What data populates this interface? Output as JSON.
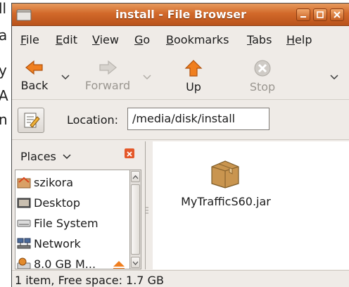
{
  "background_doc": {
    "lines": [
      "ll",
      "a",
      "y",
      "A",
      "n"
    ]
  },
  "window": {
    "title": "install - File Browser",
    "controls": {
      "minimize": "minimize",
      "maximize": "maximize",
      "close": "close"
    }
  },
  "menubar": {
    "items": [
      {
        "label": "File",
        "mnemonic": "F",
        "rest": "ile"
      },
      {
        "label": "Edit",
        "mnemonic": "E",
        "rest": "dit"
      },
      {
        "label": "View",
        "mnemonic": "V",
        "rest": "iew"
      },
      {
        "label": "Go",
        "mnemonic": "G",
        "rest": "o"
      },
      {
        "label": "Bookmarks",
        "mnemonic": "B",
        "rest": "ookmarks"
      },
      {
        "label": "Tabs",
        "mnemonic": "T",
        "rest": "abs"
      },
      {
        "label": "Help",
        "mnemonic": "H",
        "rest": "elp"
      }
    ]
  },
  "toolbar": {
    "back": {
      "label": "Back",
      "enabled": true,
      "icon": "back-arrow-icon"
    },
    "forward": {
      "label": "Forward",
      "enabled": false,
      "icon": "forward-arrow-icon"
    },
    "up": {
      "label": "Up",
      "enabled": true,
      "icon": "up-arrow-icon"
    },
    "stop": {
      "label": "Stop",
      "enabled": false,
      "icon": "stop-icon"
    }
  },
  "location": {
    "label": "Location:",
    "value": "/media/disk/install"
  },
  "sidebar": {
    "header": "Places",
    "items": [
      {
        "label": "szikora",
        "icon": "home-folder-icon"
      },
      {
        "label": "Desktop",
        "icon": "desktop-icon"
      },
      {
        "label": "File System",
        "icon": "drive-icon"
      },
      {
        "label": "Network",
        "icon": "network-icon"
      },
      {
        "label": "8.0 GB M...",
        "icon": "usb-drive-icon"
      }
    ]
  },
  "content": {
    "files": [
      {
        "name": "MyTrafficS60.jar",
        "icon": "package-icon"
      }
    ]
  },
  "statusbar": {
    "text": "1 item, Free space: 1.7 GB"
  },
  "colors": {
    "titlebar": "#d2692a",
    "accent": "#f07f1f",
    "window_bg": "#efebe7"
  }
}
